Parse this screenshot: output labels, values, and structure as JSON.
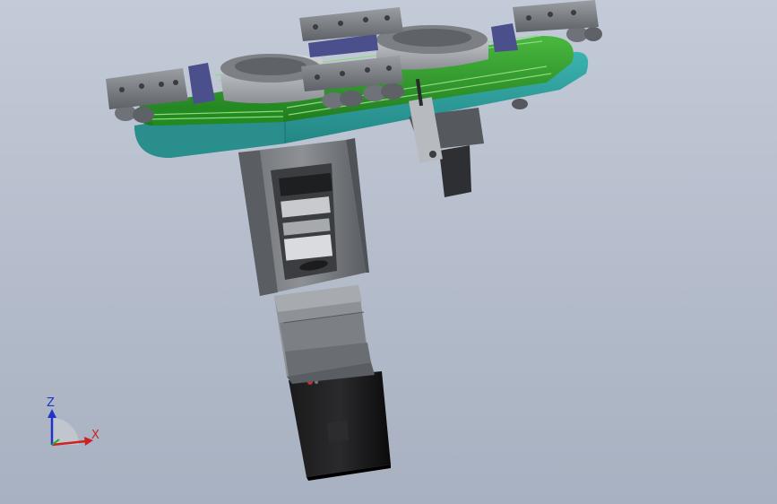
{
  "viewport": {
    "background_top": "#c3cbd8",
    "background_bottom": "#a8b1c1"
  },
  "model": {
    "colors": {
      "plate_green": "#2f9a2c",
      "plate_teal": "#2e9b99",
      "block_grey": "#7a7d82",
      "motor_black": "#0f0f10",
      "bracket_blue": "#4b4f8c"
    }
  },
  "triad": {
    "z_label": "Z",
    "x_label": "X",
    "z_color": "#2233cc",
    "x_color": "#cc2222"
  }
}
